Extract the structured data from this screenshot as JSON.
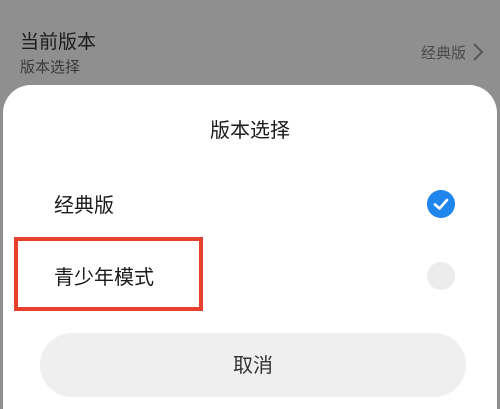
{
  "background": {
    "row_title": "当前版本",
    "row_subtitle": "版本选择",
    "row_value": "经典版",
    "row_chevron_icon": "chevron-right-icon"
  },
  "sheet": {
    "title": "版本选择",
    "options": [
      {
        "label": "经典版",
        "selected": true
      },
      {
        "label": "青少年模式",
        "selected": false
      }
    ],
    "cancel_label": "取消"
  },
  "colors": {
    "accent": "#1f86ee",
    "highlight": "#e7402f",
    "overlay": "#8f8f8f"
  }
}
